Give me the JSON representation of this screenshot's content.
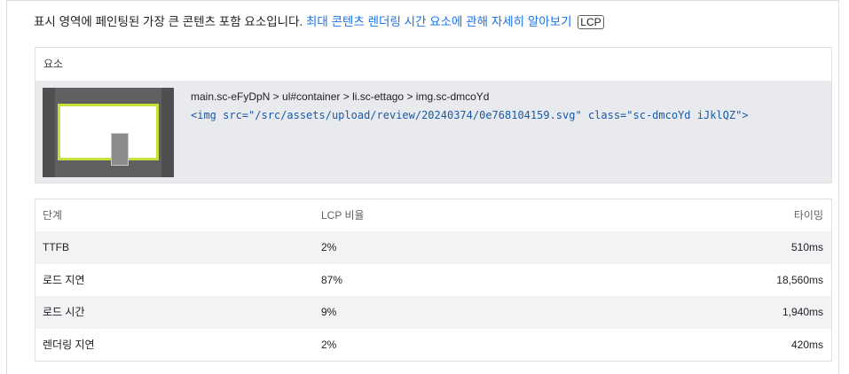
{
  "description": {
    "text": "표시 영역에 페인팅된 가장 큰 콘텐츠 포함 요소입니다.",
    "link": "최대 콘텐츠 렌더링 시간 요소에 관해 자세히 알아보기",
    "chip": "LCP"
  },
  "element_card": {
    "header": "요소",
    "selector": "main.sc-eFyDpN > ul#container > li.sc-ettago > img.sc-dmcoYd",
    "snippet": "<img src=\"/src/assets/upload/review/20240374/0e768104159.svg\" class=\"sc-dmcoYd iJklQZ\">"
  },
  "phase_table": {
    "headers": [
      "단계",
      "LCP 비율",
      "타이밍"
    ],
    "rows": [
      {
        "phase": "TTFB",
        "ratio": "2%",
        "timing": "510ms"
      },
      {
        "phase": "로드 지연",
        "ratio": "87%",
        "timing": "18,560ms"
      },
      {
        "phase": "로드 시간",
        "ratio": "9%",
        "timing": "1,940ms"
      },
      {
        "phase": "렌더링 지연",
        "ratio": "2%",
        "timing": "420ms"
      }
    ]
  }
}
